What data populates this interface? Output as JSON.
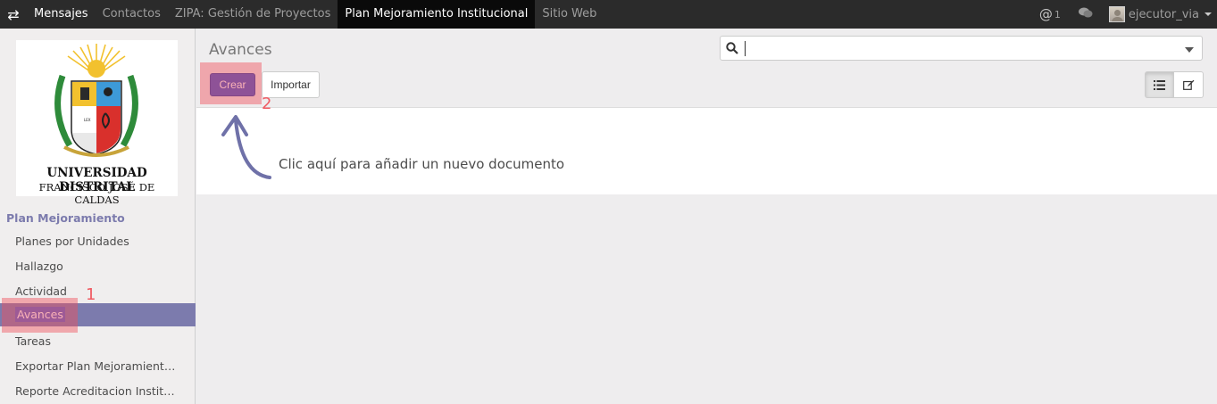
{
  "topbar": {
    "toggle_icon": "exchange-icon",
    "items": [
      {
        "label": "Mensajes"
      },
      {
        "label": "Contactos"
      },
      {
        "label": "ZIPA: Gestión de Proyectos"
      },
      {
        "label": "Plan Mejoramiento Institucional"
      },
      {
        "label": "Sitio Web"
      }
    ],
    "mentions_count": "1",
    "user": "ejecutor_via"
  },
  "logo": {
    "line1": "UNIVERSIDAD DISTRITAL",
    "line2": "FRANCISCO JOSÉ DE CALDAS"
  },
  "sidebar": {
    "section": "Plan Mejoramiento",
    "items": [
      {
        "label": "Planes por Unidades"
      },
      {
        "label": "Hallazgo"
      },
      {
        "label": "Actividad"
      },
      {
        "label": "Avances"
      },
      {
        "label": "Tareas"
      },
      {
        "label": "Exportar Plan Mejoramient…"
      },
      {
        "label": "Reporte Acreditacion Instit…"
      }
    ],
    "active_index": 3
  },
  "main": {
    "title": "Avances",
    "search_value": "",
    "create_label": "Crear",
    "import_label": "Importar",
    "help_text": "Clic aquí para añadir un nuevo documento"
  },
  "annotations": {
    "step1": "1",
    "step2": "2",
    "highlight_color": "#f0505a"
  },
  "colors": {
    "topbar_bg": "#2b2b2b",
    "accent": "#7c7bad",
    "create_button": "#3f55c9"
  }
}
